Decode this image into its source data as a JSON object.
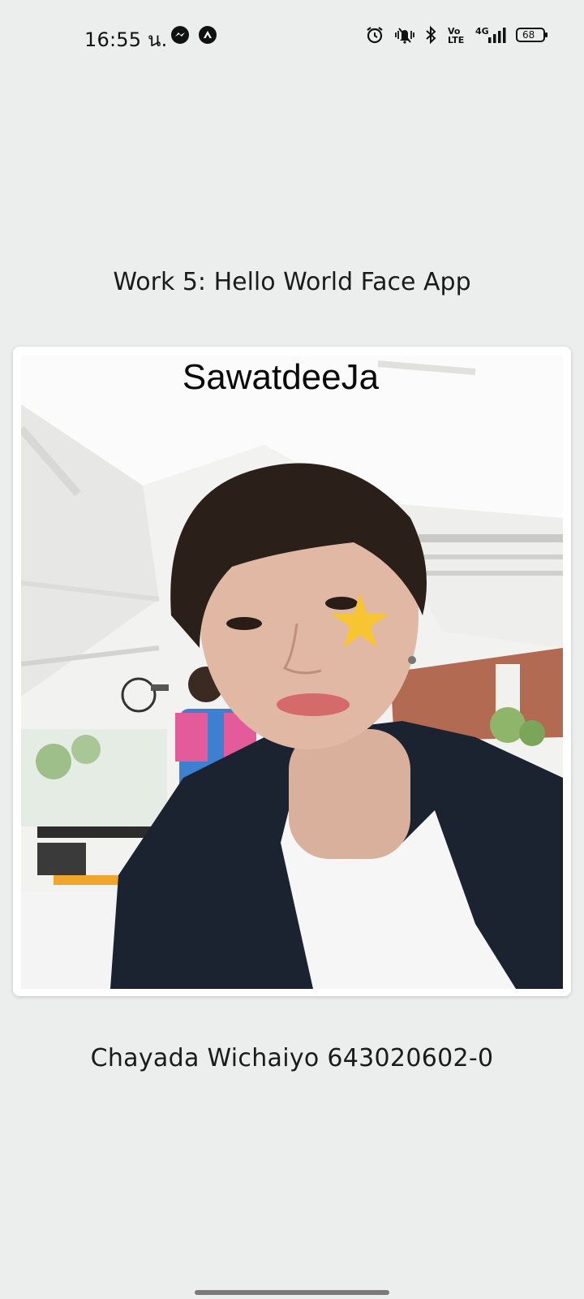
{
  "status_bar": {
    "time": "16:55 น.",
    "battery_level": "68",
    "network": "4G",
    "volte": "Vo LTE",
    "icons": [
      "messenger-icon",
      "app-notification-icon",
      "alarm-icon",
      "vibrate-icon",
      "bluetooth-icon",
      "volte-icon",
      "signal-icon",
      "battery-icon"
    ]
  },
  "app": {
    "title": "Work 5: Hello World Face App",
    "overlay_text": "SawatdeeJa",
    "footer": "Chayada Wichaiyo 643020602-0"
  },
  "colors": {
    "background": "#eceeee",
    "card": "#ffffff",
    "star": "#f7c531"
  }
}
